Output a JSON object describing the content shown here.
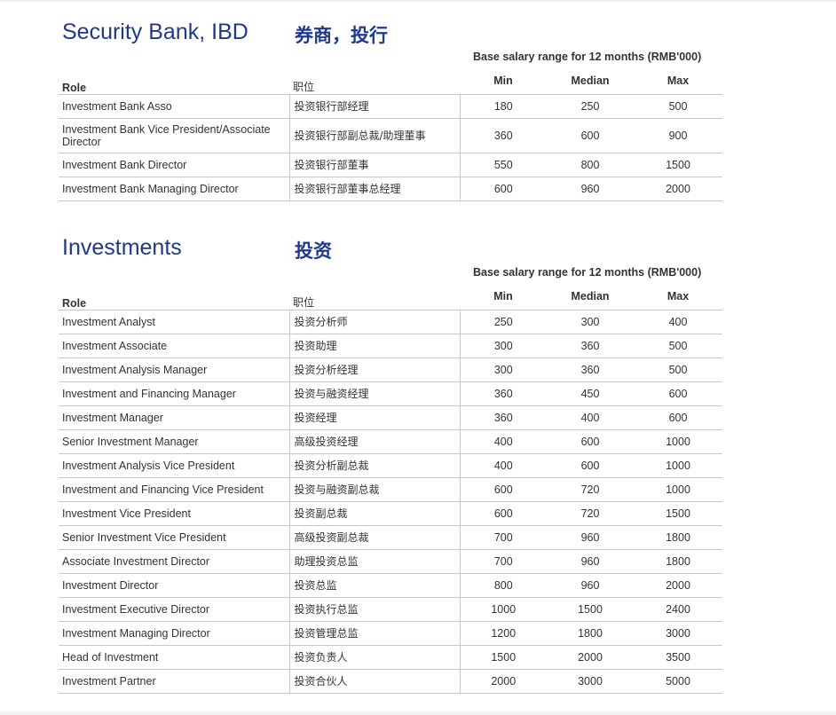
{
  "sections": [
    {
      "title_en": "Security Bank, IBD",
      "title_zh": "券商，投行",
      "range_caption": "Base salary range for 12 months (RMB'000)",
      "headers": {
        "role": "Role",
        "role_zh": "职位",
        "min": "Min",
        "median": "Median",
        "max": "Max"
      },
      "rows": [
        {
          "role": "Investment Bank Asso",
          "role_zh": "投资银行部经理",
          "min": "180",
          "median": "250",
          "max": "500"
        },
        {
          "role": "Investment Bank Vice President/Associate Director",
          "role_zh": "投资银行部副总裁/助理董事",
          "min": "360",
          "median": "600",
          "max": "900"
        },
        {
          "role": "Investment Bank Director",
          "role_zh": "投资银行部董事",
          "min": "550",
          "median": "800",
          "max": "1500"
        },
        {
          "role": "Investment Bank Managing Director",
          "role_zh": "投资银行部董事总经理",
          "min": "600",
          "median": "960",
          "max": "2000"
        }
      ]
    },
    {
      "title_en": "Investments",
      "title_zh": "投资",
      "range_caption": "Base salary range for 12 months (RMB'000)",
      "headers": {
        "role": "Role",
        "role_zh": "职位",
        "min": "Min",
        "median": "Median",
        "max": "Max"
      },
      "rows": [
        {
          "role": "Investment Analyst",
          "role_zh": "投资分析师",
          "min": "250",
          "median": "300",
          "max": "400"
        },
        {
          "role": "Investment Associate",
          "role_zh": "投资助理",
          "min": "300",
          "median": "360",
          "max": "500"
        },
        {
          "role": "Investment Analysis Manager",
          "role_zh": "投资分析经理",
          "min": "300",
          "median": "360",
          "max": "500"
        },
        {
          "role": "Investment and Financing Manager",
          "role_zh": "投资与融资经理",
          "min": "360",
          "median": "450",
          "max": "600"
        },
        {
          "role": "Investment Manager",
          "role_zh": "投资经理",
          "min": "360",
          "median": "400",
          "max": "600"
        },
        {
          "role": "Senior Investment Manager",
          "role_zh": "高级投资经理",
          "min": "400",
          "median": "600",
          "max": "1000"
        },
        {
          "role": "Investment Analysis Vice President",
          "role_zh": "投资分析副总裁",
          "min": "400",
          "median": "600",
          "max": "1000"
        },
        {
          "role": "Investment and Financing Vice President",
          "role_zh": "投资与融资副总裁",
          "min": "600",
          "median": "720",
          "max": "1000"
        },
        {
          "role": "Investment Vice President",
          "role_zh": "投资副总裁",
          "min": "600",
          "median": "720",
          "max": "1500"
        },
        {
          "role": "Senior Investment Vice President",
          "role_zh": "高级投资副总裁",
          "min": "700",
          "median": "960",
          "max": "1800"
        },
        {
          "role": "Associate Investment Director",
          "role_zh": "助理投资总监",
          "min": "700",
          "median": "960",
          "max": "1800"
        },
        {
          "role": "Investment Director",
          "role_zh": "投资总监",
          "min": "800",
          "median": "960",
          "max": "2000"
        },
        {
          "role": "Investment Executive Director",
          "role_zh": "投资执行总监",
          "min": "1000",
          "median": "1500",
          "max": "2400"
        },
        {
          "role": "Investment Managing Director",
          "role_zh": "投资管理总监",
          "min": "1200",
          "median": "1800",
          "max": "3000"
        },
        {
          "role": "Head of Investment",
          "role_zh": "投资负责人",
          "min": "1500",
          "median": "2000",
          "max": "3500"
        },
        {
          "role": "Investment Partner",
          "role_zh": "投资合伙人",
          "min": "2000",
          "median": "3000",
          "max": "5000"
        }
      ]
    }
  ]
}
